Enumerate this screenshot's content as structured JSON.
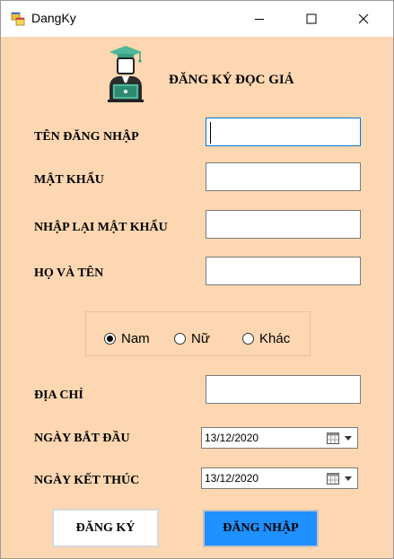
{
  "window": {
    "title": "DangKy"
  },
  "header": {
    "title": "ĐĂNG KÝ ĐỌC GIẢ"
  },
  "form": {
    "username_label": "TÊN ĐĂNG NHẬP",
    "password_label": "MẬT KHẨU",
    "confirm_password_label": "NHẬP LẠI MẬT KHẨU",
    "fullname_label": "HỌ VÀ TÊN",
    "address_label": "ĐỊA CHỈ",
    "start_date_label": "NGÀY BẮT ĐẦU",
    "end_date_label": "NGÀY KẾT THÚC",
    "username_value": "",
    "password_value": "",
    "confirm_password_value": "",
    "fullname_value": "",
    "address_value": "",
    "start_date_value": "13/12/2020",
    "end_date_value": "13/12/2020"
  },
  "gender": {
    "options": [
      "Nam",
      "Nữ",
      "Khác"
    ],
    "selected": "Nam"
  },
  "buttons": {
    "register": "ĐĂNG KÝ",
    "login": "ĐĂNG NHẬP"
  },
  "colors": {
    "form_background": "#fdd7b1",
    "login_button": "#1e90ff",
    "focus_border": "#0078d7"
  }
}
